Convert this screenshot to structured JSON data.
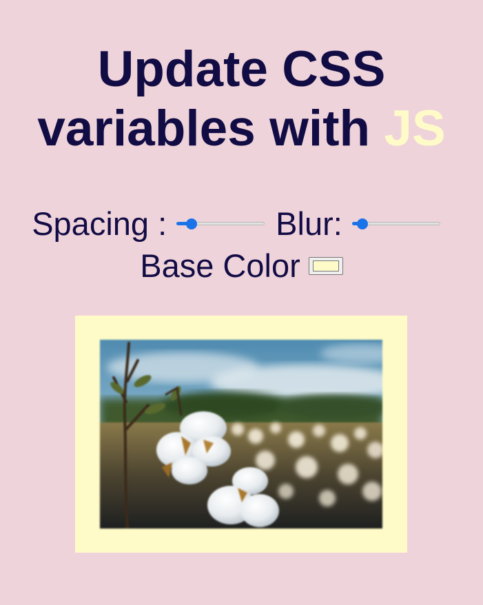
{
  "heading": {
    "line1": "Update CSS",
    "line2": "variables with",
    "highlight": "JS"
  },
  "controls": {
    "spacing": {
      "label": "Spacing :",
      "value_fraction": 0.17
    },
    "blur": {
      "label": "Blur:",
      "value_fraction": 0.12
    },
    "base_color": {
      "label": "Base Color",
      "value": "#fffbc9"
    }
  },
  "colors": {
    "page_background": "#efd3da",
    "text": "#120c45",
    "accent": "#fffbc9",
    "slider": "#1a73e8"
  },
  "image": {
    "subject": "blurred photo of cotton bolls in a field"
  }
}
